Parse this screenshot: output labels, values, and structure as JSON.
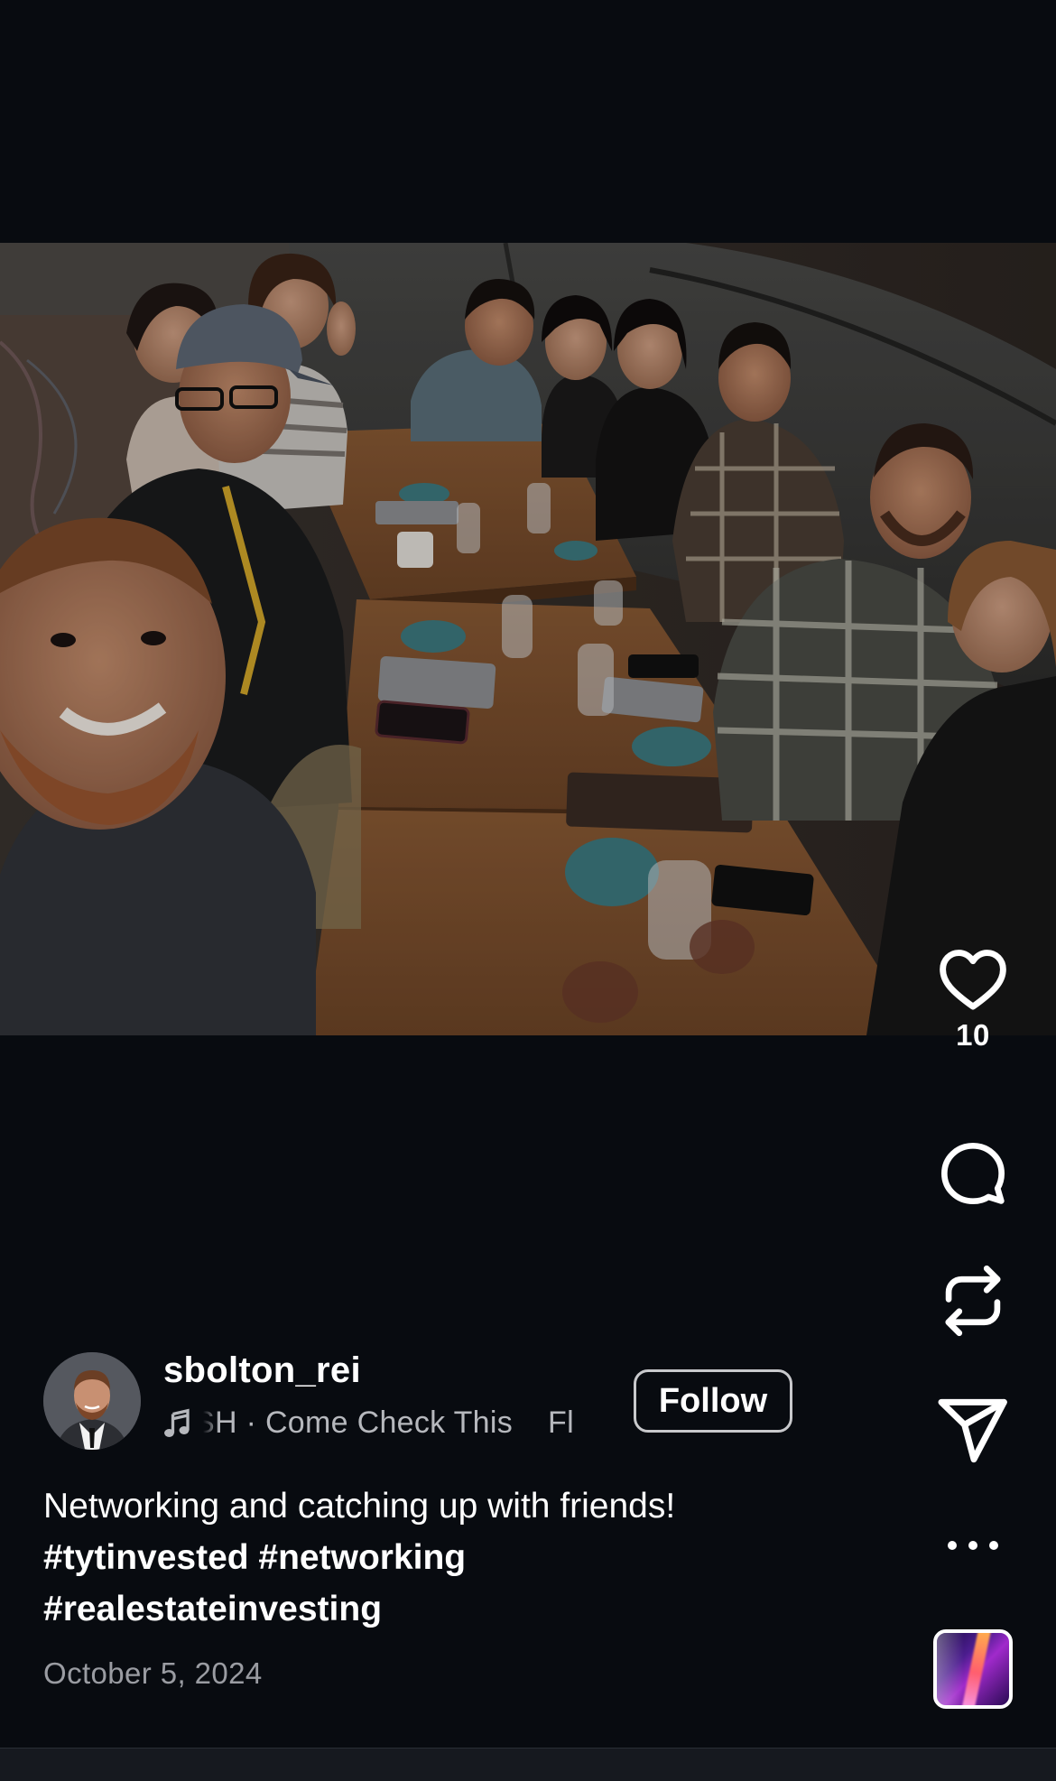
{
  "post": {
    "image_alt": "Group selfie of twelve people seated around restaurant tables",
    "likes": "10",
    "author": {
      "username": "sbolton_rei",
      "follow_label": "Follow"
    },
    "audio": {
      "text": "SH · Come Check This    Fl"
    },
    "caption": {
      "text": "Networking and catching up with friends!",
      "hashtags_line1": "#tytinvested #networking",
      "hashtags_line2": "#realestateinvesting"
    },
    "date": "October 5, 2024"
  },
  "icons": {
    "like": "heart-icon",
    "comment": "comment-bubble-icon",
    "repost": "repost-icon",
    "share": "paper-plane-icon",
    "more": "more-dots-icon",
    "music": "music-note-icon"
  },
  "colors": {
    "background": "#080b10",
    "secondary_text": "#9a9ca2",
    "follow_border": "#c8c9cc"
  }
}
